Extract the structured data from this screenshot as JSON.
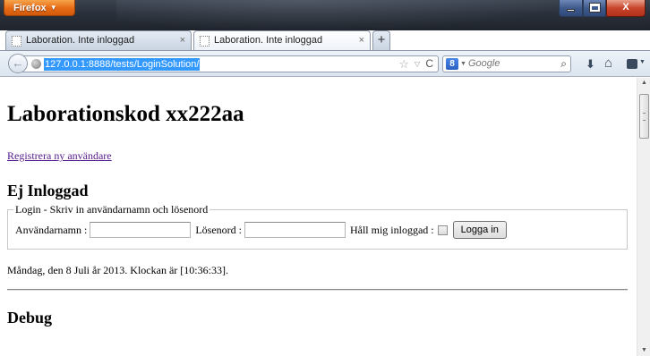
{
  "browser": {
    "app_button_label": "Firefox",
    "tabs": [
      {
        "title": "Laboration. Inte inloggad",
        "active": false
      },
      {
        "title": "Laboration. Inte inloggad",
        "active": true
      }
    ],
    "tab_close_glyph": "×",
    "new_tab_glyph": "+",
    "url": "127.0.0.1:8888/tests/LoginSolution/",
    "search_engine_letter": "8",
    "search_placeholder": "Google"
  },
  "page": {
    "title": "Laborationskod xx222aa",
    "register_link": "Registrera ny användare",
    "status_heading": "Ej Inloggad",
    "login_form": {
      "legend": "Login - Skriv in användarnamn och lösenord",
      "username_label": "Användarnamn :",
      "username_value": "",
      "password_label": "Lösenord :",
      "password_value": "",
      "remember_label": "Håll mig inloggad :",
      "remember_checked": false,
      "submit_label": "Logga in"
    },
    "date_text": "Måndag, den 8 Juli år 2013. Klockan är [10:36:33].",
    "debug_heading": "Debug"
  },
  "colors": {
    "link_visited": "#551a8b",
    "url_selection": "#3399ff",
    "firefox_orange": "#e66a16"
  }
}
